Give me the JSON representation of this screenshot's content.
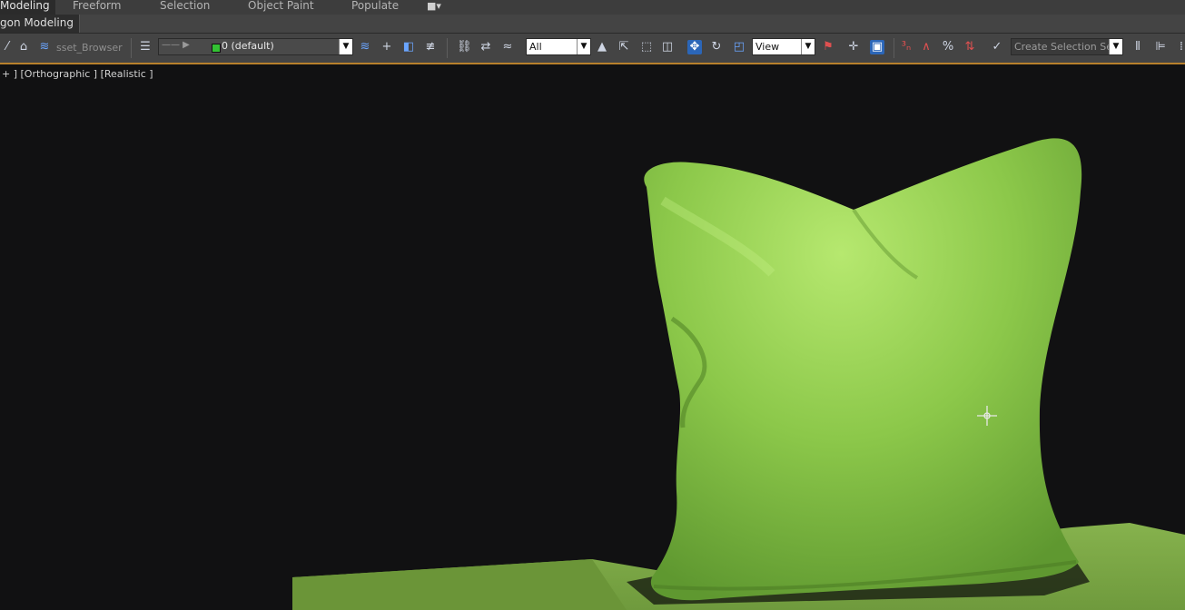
{
  "ribbon": {
    "tabs": [
      {
        "label": "Modeling",
        "active": true
      },
      {
        "label": "Freeform",
        "active": false
      },
      {
        "label": "Selection",
        "active": false
      },
      {
        "label": "Object Paint",
        "active": false
      },
      {
        "label": "Populate",
        "active": false
      }
    ],
    "sub_tab": "gon Modeling"
  },
  "toolbar": {
    "asset_browser_label": "sset_Browser",
    "layer_value": "0 (default)",
    "selection_filter": "All",
    "reference_coord": "View",
    "named_selection_placeholder": "Create Selection Se"
  },
  "viewport": {
    "label": "+ ] [Orthographic ] [Realistic ]",
    "object_color": "#8cc84a",
    "ground_color": "#79a845",
    "background_color": "#111112"
  },
  "icons": [
    "camera-icon",
    "undo-icon",
    "link-icon",
    "select-move-icon",
    "rotate-icon",
    "scale-icon",
    "snap-icon",
    "mirror-icon",
    "align-icon",
    "move-cursor-icon"
  ]
}
